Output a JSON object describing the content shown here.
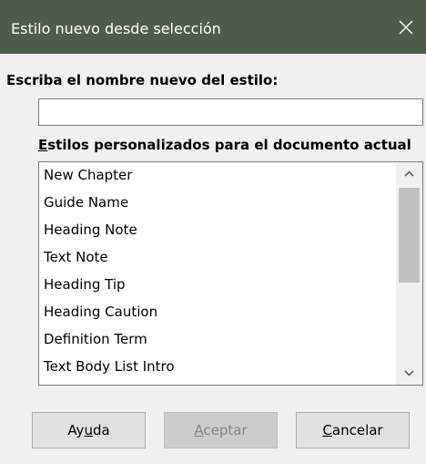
{
  "window": {
    "title": "Estilo nuevo desde selección",
    "close_icon": "close-icon"
  },
  "form": {
    "name_label": "Escriba el nombre nuevo del estilo:",
    "name_value": "",
    "list_label_mnemonic": "E",
    "list_label_rest": "stilos personalizados para el documento actual"
  },
  "styles_list": {
    "items": [
      "New Chapter",
      "Guide Name",
      "Heading Note",
      "Text Note",
      "Heading Tip",
      "Heading Caution",
      "Definition Term",
      "Text Body List Intro"
    ],
    "scroll_up_icon": "chevron-up-icon",
    "scroll_down_icon": "chevron-down-icon"
  },
  "buttons": {
    "help_pre": "Ay",
    "help_mn": "u",
    "help_post": "da",
    "ok_mn": "A",
    "ok_post": "ceptar",
    "cancel_mn": "C",
    "cancel_post": "ancelar"
  },
  "colors": {
    "titlebar_bg": "#4e5d4a",
    "dialog_bg": "#f0f0f0",
    "disabled_text": "#838383"
  }
}
